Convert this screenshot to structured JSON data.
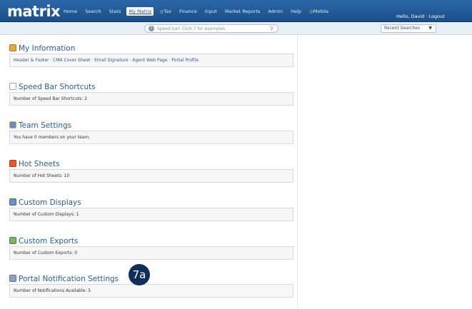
{
  "header": {
    "logo": "matrix",
    "nav": [
      {
        "label": "Home"
      },
      {
        "label": "Search"
      },
      {
        "label": "Stats"
      },
      {
        "label": "My Matrix",
        "active": true
      },
      {
        "label": "Tax",
        "prefix_icon": "globe-icon"
      },
      {
        "label": "Finance"
      },
      {
        "label": "Input"
      },
      {
        "label": "Market Reports"
      },
      {
        "label": "Admin"
      },
      {
        "label": "Help"
      },
      {
        "label": "Mobile",
        "prefix_icon": "globe-icon"
      }
    ],
    "user_text": "Hello, David · Logout"
  },
  "speedbar": {
    "placeholder": "Speed bar! Click ? for examples",
    "recent_searches": "Recent Searches"
  },
  "sections": [
    {
      "title": "My Information",
      "icon": "profile-card-icon",
      "links": [
        "Header & Footer",
        "CMA Cover Sheet",
        "Email Signature",
        "Agent Web Page",
        "Portal Profile"
      ]
    },
    {
      "title": "Speed Bar Shortcuts",
      "icon": "shortcut-icon",
      "text": "Number of Speed Bar Shortcuts: 2"
    },
    {
      "title": "Team Settings",
      "icon": "team-icon",
      "text": "You have 0 members on your team."
    },
    {
      "title": "Hot Sheets",
      "icon": "hot-sheet-icon",
      "text": "Number of Hot Sheets: 10"
    },
    {
      "title": "Custom Displays",
      "icon": "display-icon",
      "text": "Number of Custom Displays: 1"
    },
    {
      "title": "Custom Exports",
      "icon": "export-icon",
      "text": "Number of Custom Exports: 0"
    },
    {
      "title": "Portal Notification Settings",
      "icon": "notification-icon",
      "text": "Number of Notifications Available: 5"
    }
  ],
  "annotation": "7a",
  "colors": {
    "header": "#1f5a98",
    "section_title": "#2a5d97",
    "badge": "#0f2f5a"
  }
}
